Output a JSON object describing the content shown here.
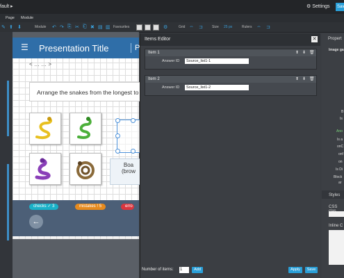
{
  "topbar": {
    "title": "fault  ▸",
    "settings": "⚙ Settings",
    "save": "Sav"
  },
  "menubar": {
    "items": [
      "Page",
      "Module"
    ]
  },
  "toolbar": {
    "module_label": "Module",
    "favourites_label": "Favourites",
    "grid_label": "Grid",
    "size_label": "Size",
    "size_value": "25 px",
    "rulers_label": "Rulers"
  },
  "slide": {
    "title": "Presentation Title",
    "page_label": "Pag",
    "nav": "<   …   …   >",
    "question": "Arrange the snakes from the longest to",
    "board_text": "Boa\n(brow"
  },
  "footer": {
    "checks_label": "checks",
    "checks_count": "3",
    "mistakes_label": "mistakes",
    "mistakes_count": "5",
    "errors_label": "erro"
  },
  "items_editor": {
    "title": "Items Editor",
    "items": [
      {
        "name": "Item 1",
        "answer_label": "Answer ID",
        "answer_value": "Source_list1-1"
      },
      {
        "name": "Item 2",
        "answer_label": "Answer ID",
        "answer_value": "Source_list1-2"
      }
    ],
    "number_label": "Number of items:",
    "number_value": "1",
    "add": "Add",
    "apply": "Apply",
    "save": "Save"
  },
  "right_panel": {
    "header": "Propert",
    "image_label": "Image ga",
    "labels": [
      "B",
      "Is",
      "Ano",
      "Is a",
      "onC",
      "onf",
      "on",
      "Is Di",
      "Block",
      "ar"
    ],
    "styles": "Styles",
    "css_class": "CSS clas",
    "inline": "Inline C"
  },
  "colors": {
    "accent": "#2a9fd8",
    "header_blue": "#2f6ea8",
    "checks": "#1ab1c8",
    "mistakes": "#e68a1e",
    "errors": "#d9363e"
  }
}
